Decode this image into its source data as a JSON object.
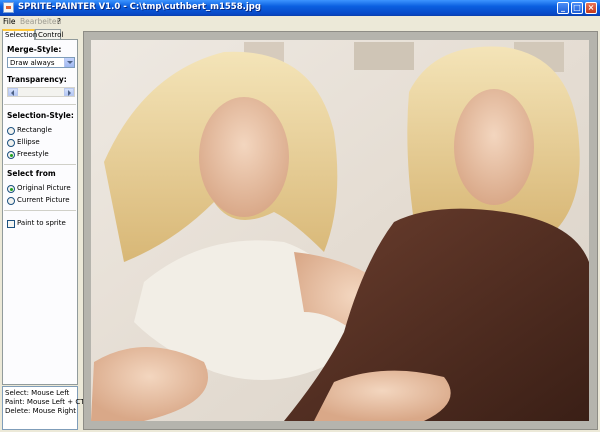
{
  "window": {
    "title": "SPRITE-PAINTER V1.0 - C:\\tmp\\cuthbert_m1558.jpg"
  },
  "menu": {
    "file": "File",
    "edit": "Bearbeiten",
    "help": "?"
  },
  "tabs": [
    {
      "label": "Selection"
    },
    {
      "label": "Control"
    }
  ],
  "merge_style": {
    "label": "Merge-Style:",
    "value": "Draw always"
  },
  "transparency": {
    "label": "Transparency:",
    "level": 0
  },
  "selection_style": {
    "label": "Selection-Style:",
    "options": [
      "Rectangle",
      "Ellipse",
      "Freestyle"
    ],
    "selected": "Freestyle"
  },
  "select_from": {
    "label": "Select from",
    "options": [
      "Original Picture",
      "Current Picture"
    ],
    "selected": "Original Picture"
  },
  "paint_to_sprite": {
    "label": "Paint to sprite",
    "checked": false
  },
  "help_text": [
    "Select: Mouse Left",
    "Paint: Mouse Left + CTRL",
    "Delete: Mouse Right"
  ]
}
